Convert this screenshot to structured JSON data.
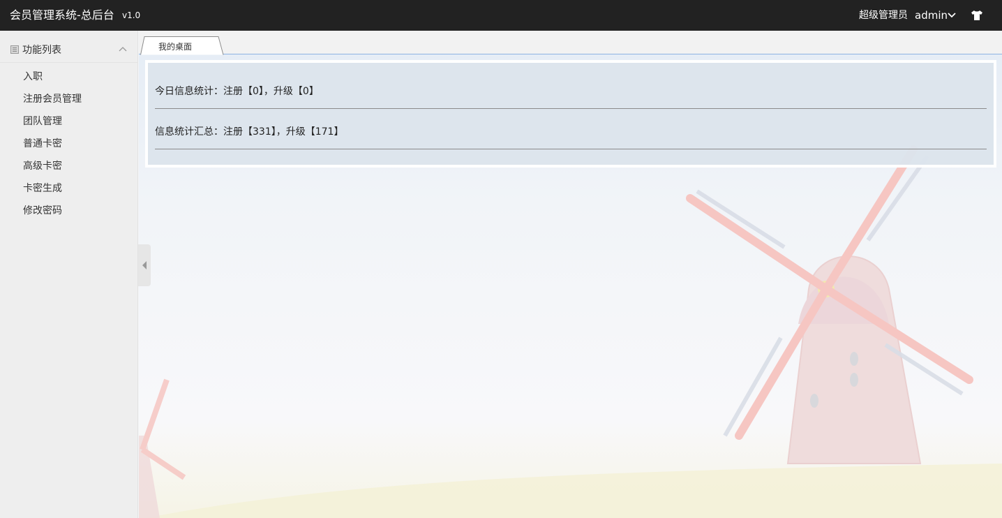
{
  "header": {
    "title": "会员管理系统-总后台",
    "version": "v1.0",
    "role": "超级管理员",
    "username": "admin"
  },
  "sidebar": {
    "section_label": "功能列表",
    "items": [
      {
        "label": "入职"
      },
      {
        "label": "注册会员管理"
      },
      {
        "label": "团队管理"
      },
      {
        "label": "普通卡密"
      },
      {
        "label": "高级卡密"
      },
      {
        "label": "卡密生成"
      },
      {
        "label": "修改密码"
      }
    ]
  },
  "tabs": [
    {
      "label": "我的桌面"
    }
  ],
  "dashboard": {
    "today_stats": "今日信息统计：注册【0】，升级【0】",
    "total_stats": "信息统计汇总：注册【331】，升级【171】"
  },
  "icons": [
    "list-icon",
    "chevron-up-icon",
    "chevron-down-icon",
    "shirt-icon",
    "collapse-arrow-icon"
  ],
  "colors": {
    "topbar": "#222222",
    "sidebar": "#eeeeee",
    "tab_border": "#8db2e3",
    "panel": "#dce4ec"
  }
}
